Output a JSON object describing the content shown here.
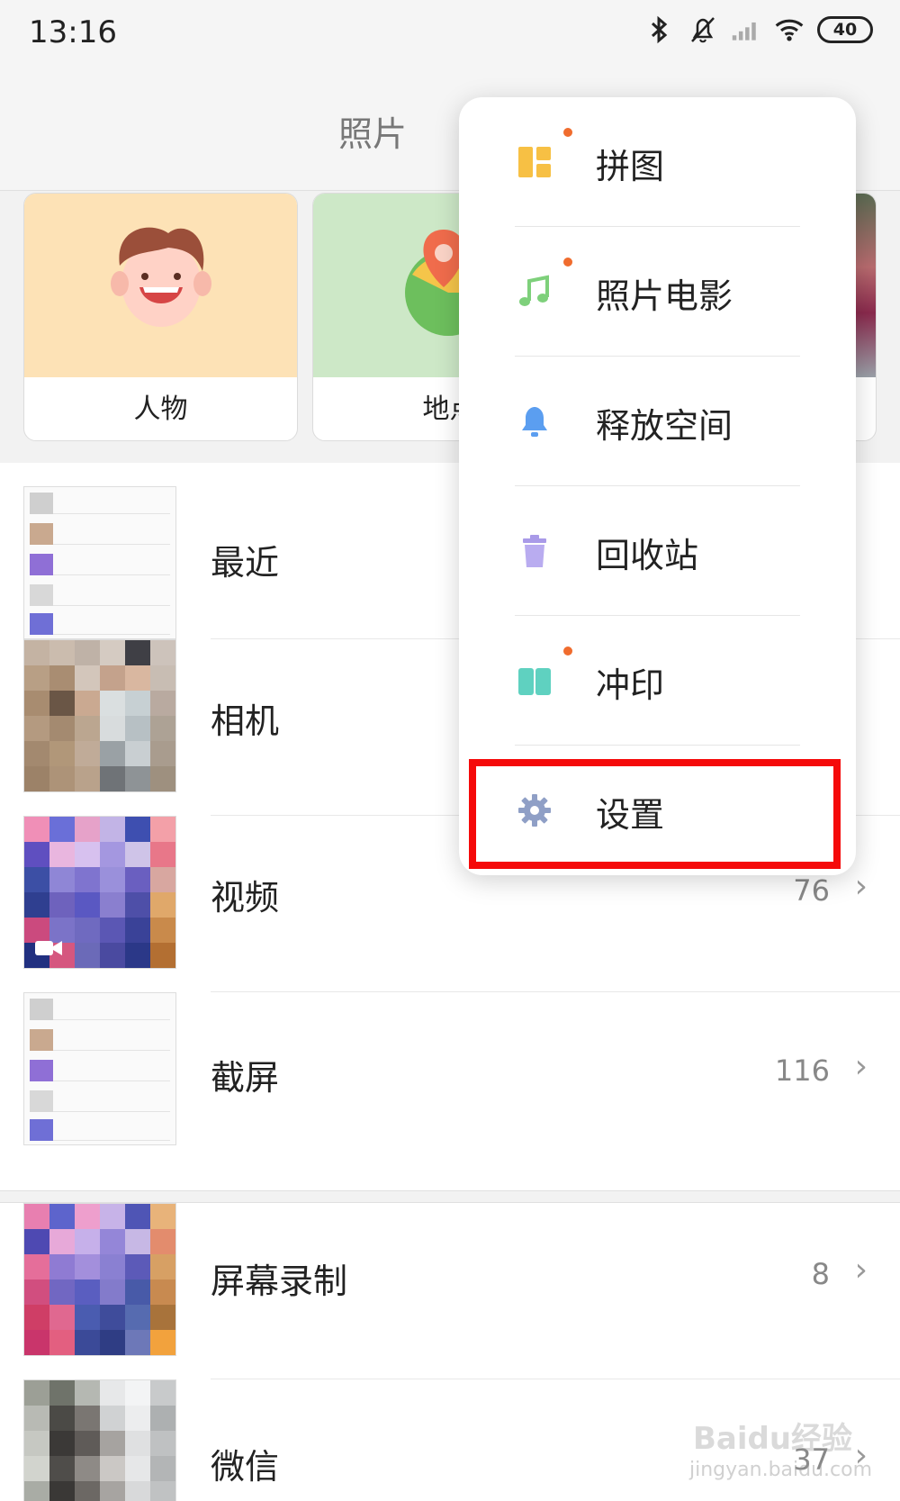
{
  "status_bar": {
    "time": "13:16",
    "battery": "40"
  },
  "header": {
    "title": "照片"
  },
  "categories": [
    {
      "label": "人物"
    },
    {
      "label": "地点"
    }
  ],
  "albums": [
    {
      "name": "最近",
      "count": ""
    },
    {
      "name": "相机",
      "count": ""
    },
    {
      "name": "视频",
      "count": "76"
    },
    {
      "name": "截屏",
      "count": "116"
    },
    {
      "name": "屏幕录制",
      "count": "8"
    },
    {
      "name": "微信",
      "count": "37"
    }
  ],
  "menu": {
    "items": [
      {
        "label": "拼图",
        "icon": "collage-icon",
        "new": true
      },
      {
        "label": "照片电影",
        "icon": "music-note-icon",
        "new": true
      },
      {
        "label": "释放空间",
        "icon": "bell-icon",
        "new": false
      },
      {
        "label": "回收站",
        "icon": "trash-icon",
        "new": false
      },
      {
        "label": "冲印",
        "icon": "print-icon",
        "new": true
      },
      {
        "label": "设置",
        "icon": "gear-icon",
        "new": false
      }
    ],
    "highlighted": "设置"
  },
  "watermark": {
    "logo": "Baidu经验",
    "url": "jingyan.baidu.com"
  },
  "colors": {
    "highlight": "#f50a0a",
    "new_dot": "#f06c2e"
  }
}
